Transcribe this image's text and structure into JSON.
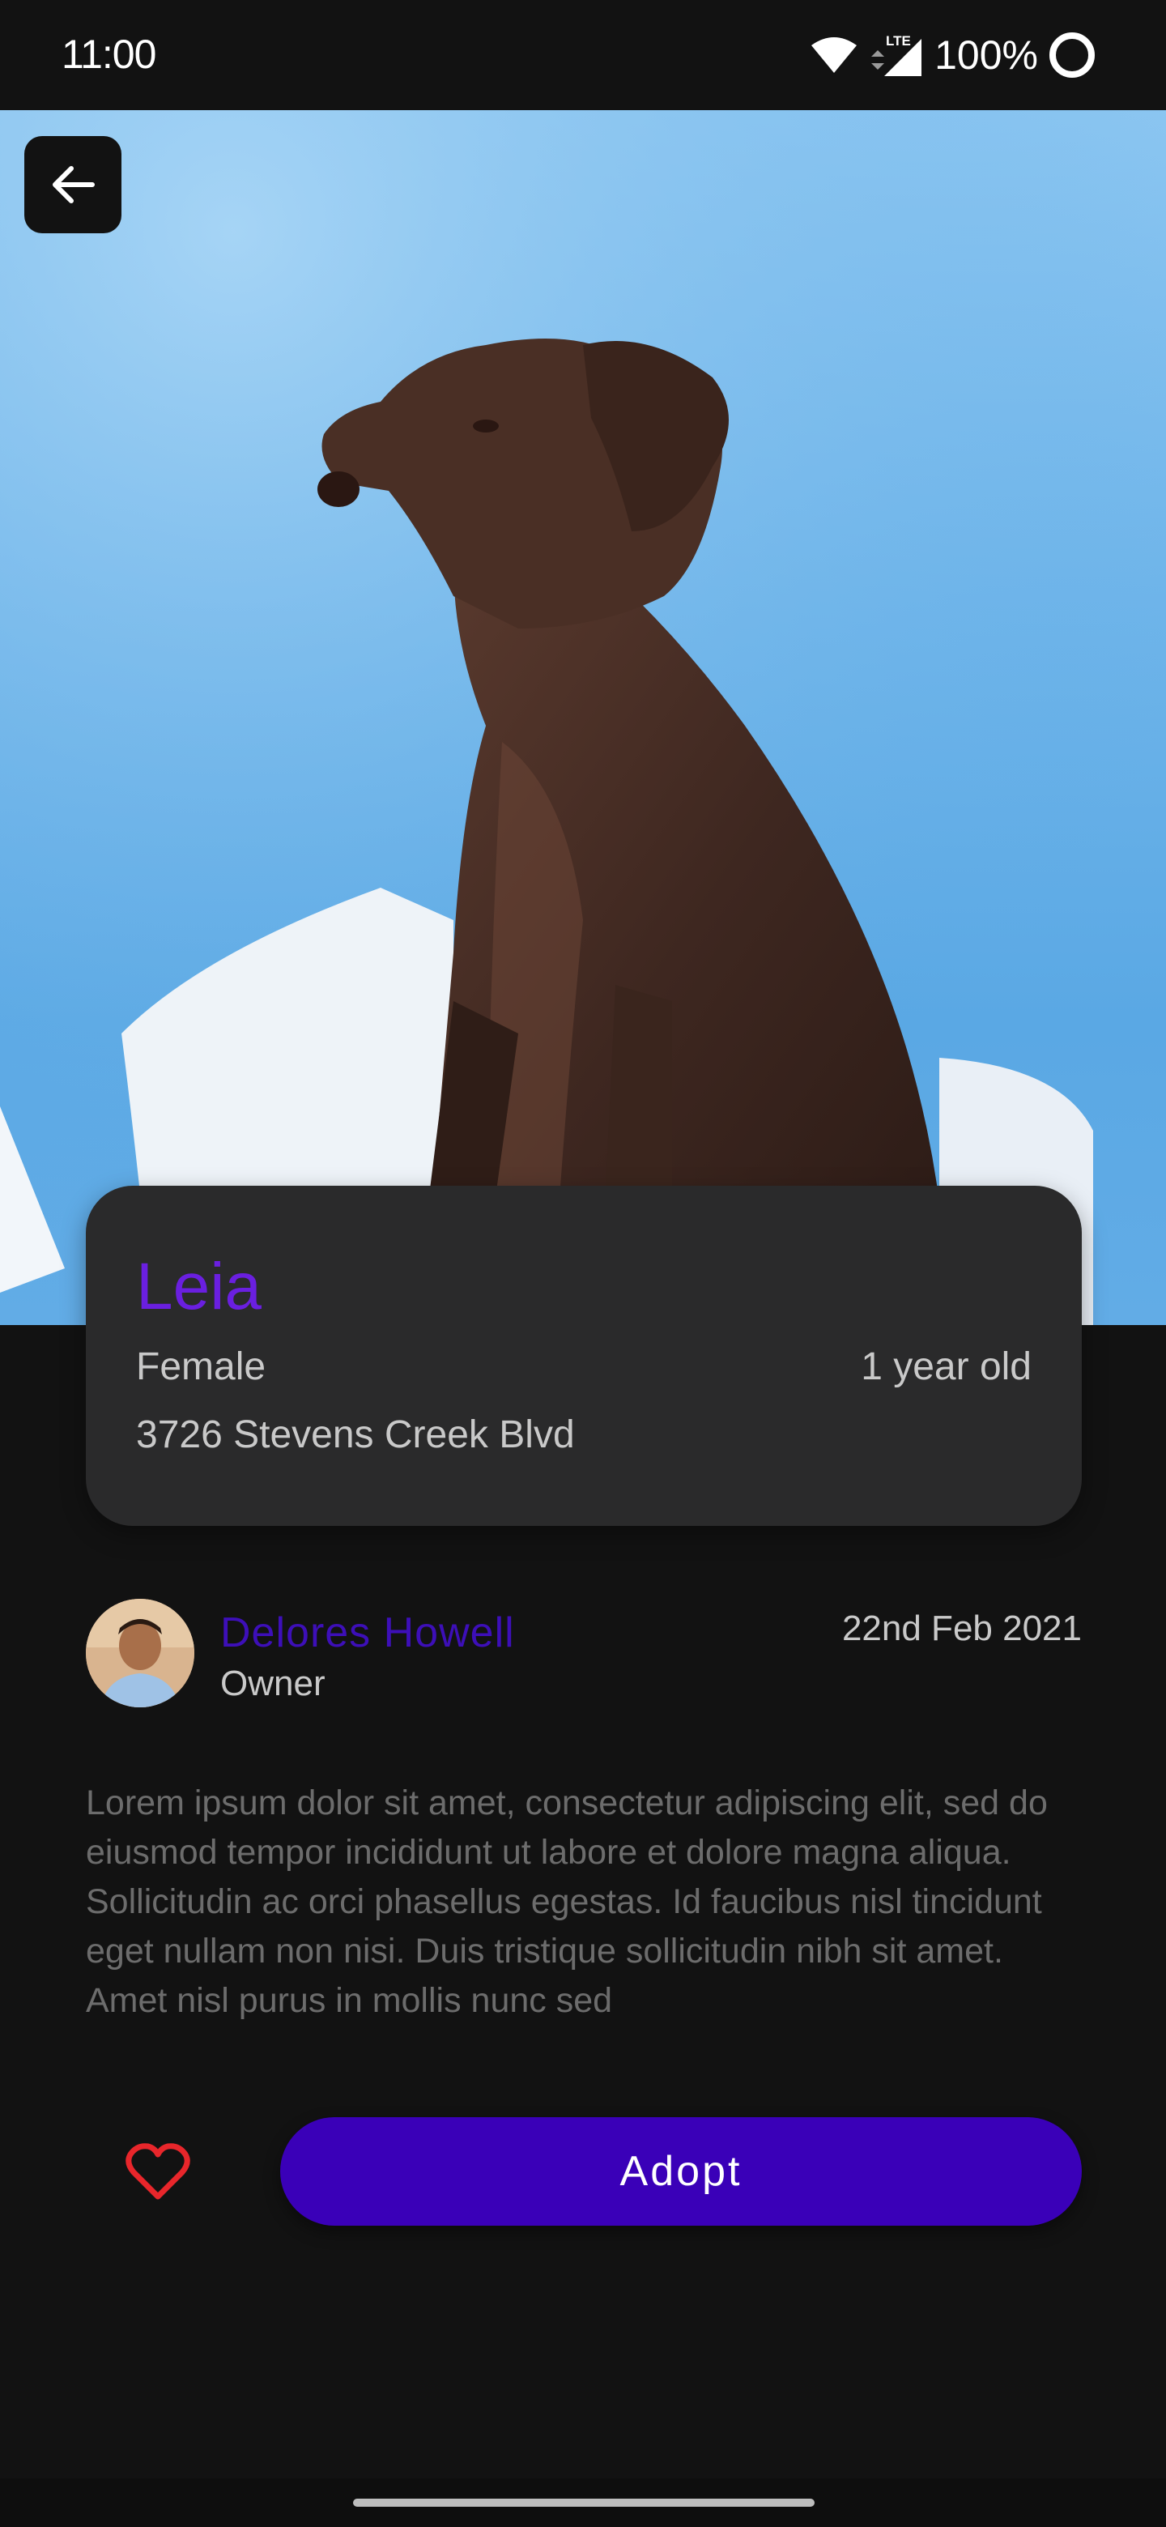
{
  "status_bar": {
    "time": "11:00",
    "network": "LTE",
    "battery": "100%"
  },
  "header": {
    "back_icon": "arrow-left-icon"
  },
  "pet": {
    "name": "Leia",
    "gender": "Female",
    "age": "1 year old",
    "address": "3726 Stevens Creek Blvd"
  },
  "owner": {
    "name": "Delores Howell",
    "role": "Owner",
    "date": "22nd Feb 2021"
  },
  "description": "Lorem ipsum dolor sit amet, consectetur adipiscing elit, sed do eiusmod tempor incididunt ut labore et dolore magna aliqua. Sollicitudin ac orci phasellus egestas. Id faucibus nisl tincidunt eget nullam non nisi. Duis tristique sollicitudin nibh sit amet. Amet nisl purus in mollis nunc sed",
  "actions": {
    "favorite_icon": "heart-icon",
    "adopt_label": "Adopt"
  },
  "colors": {
    "accent": "#3a00b8",
    "pet_name": "#6a1fe0",
    "favorite": "#e8262b",
    "background": "#121212",
    "card": "#2a2a2b"
  }
}
